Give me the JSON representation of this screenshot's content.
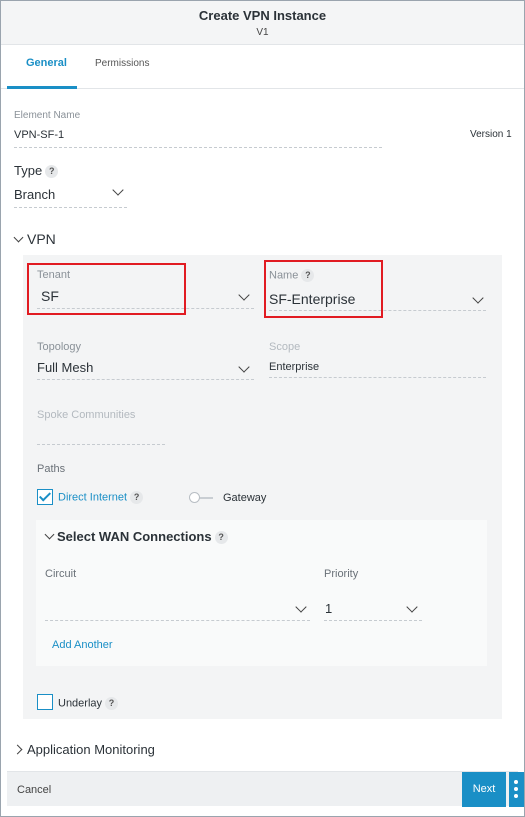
{
  "header": {
    "title": "Create VPN Instance",
    "subtitle": "V1"
  },
  "tabs": [
    {
      "label": "General",
      "active": true
    },
    {
      "label": "Permissions",
      "active": false
    }
  ],
  "element_name": {
    "label": "Element Name",
    "value": "VPN-SF-1",
    "version": "Version 1"
  },
  "type": {
    "label": "Type",
    "help": "?",
    "value": "Branch"
  },
  "vpn": {
    "title": "VPN",
    "tenant": {
      "label": "Tenant",
      "value": "SF"
    },
    "name": {
      "label": "Name",
      "help": "?",
      "value": "SF-Enterprise"
    },
    "topology": {
      "label": "Topology",
      "value": "Full Mesh"
    },
    "scope": {
      "label": "Scope",
      "value": "Enterprise"
    },
    "spoke_communities": {
      "label": "Spoke Communities",
      "value": ""
    },
    "paths": {
      "label": "Paths",
      "direct_internet": {
        "label": "Direct Internet",
        "help": "?",
        "checked": true
      },
      "gateway": {
        "label": "Gateway",
        "on": false
      }
    },
    "wan": {
      "title": "Select WAN Connections",
      "help": "?",
      "circuit": {
        "label": "Circuit",
        "value": ""
      },
      "priority": {
        "label": "Priority",
        "value": "1"
      },
      "add_another": "Add Another"
    },
    "underlay": {
      "label": "Underlay",
      "help": "?",
      "checked": false
    }
  },
  "app_monitoring": {
    "title": "Application Monitoring"
  },
  "footer": {
    "cancel": "Cancel",
    "next": "Next"
  },
  "colors": {
    "accent": "#1a8fc6",
    "highlight": "#e11b22",
    "panel": "#f3f4f5"
  }
}
